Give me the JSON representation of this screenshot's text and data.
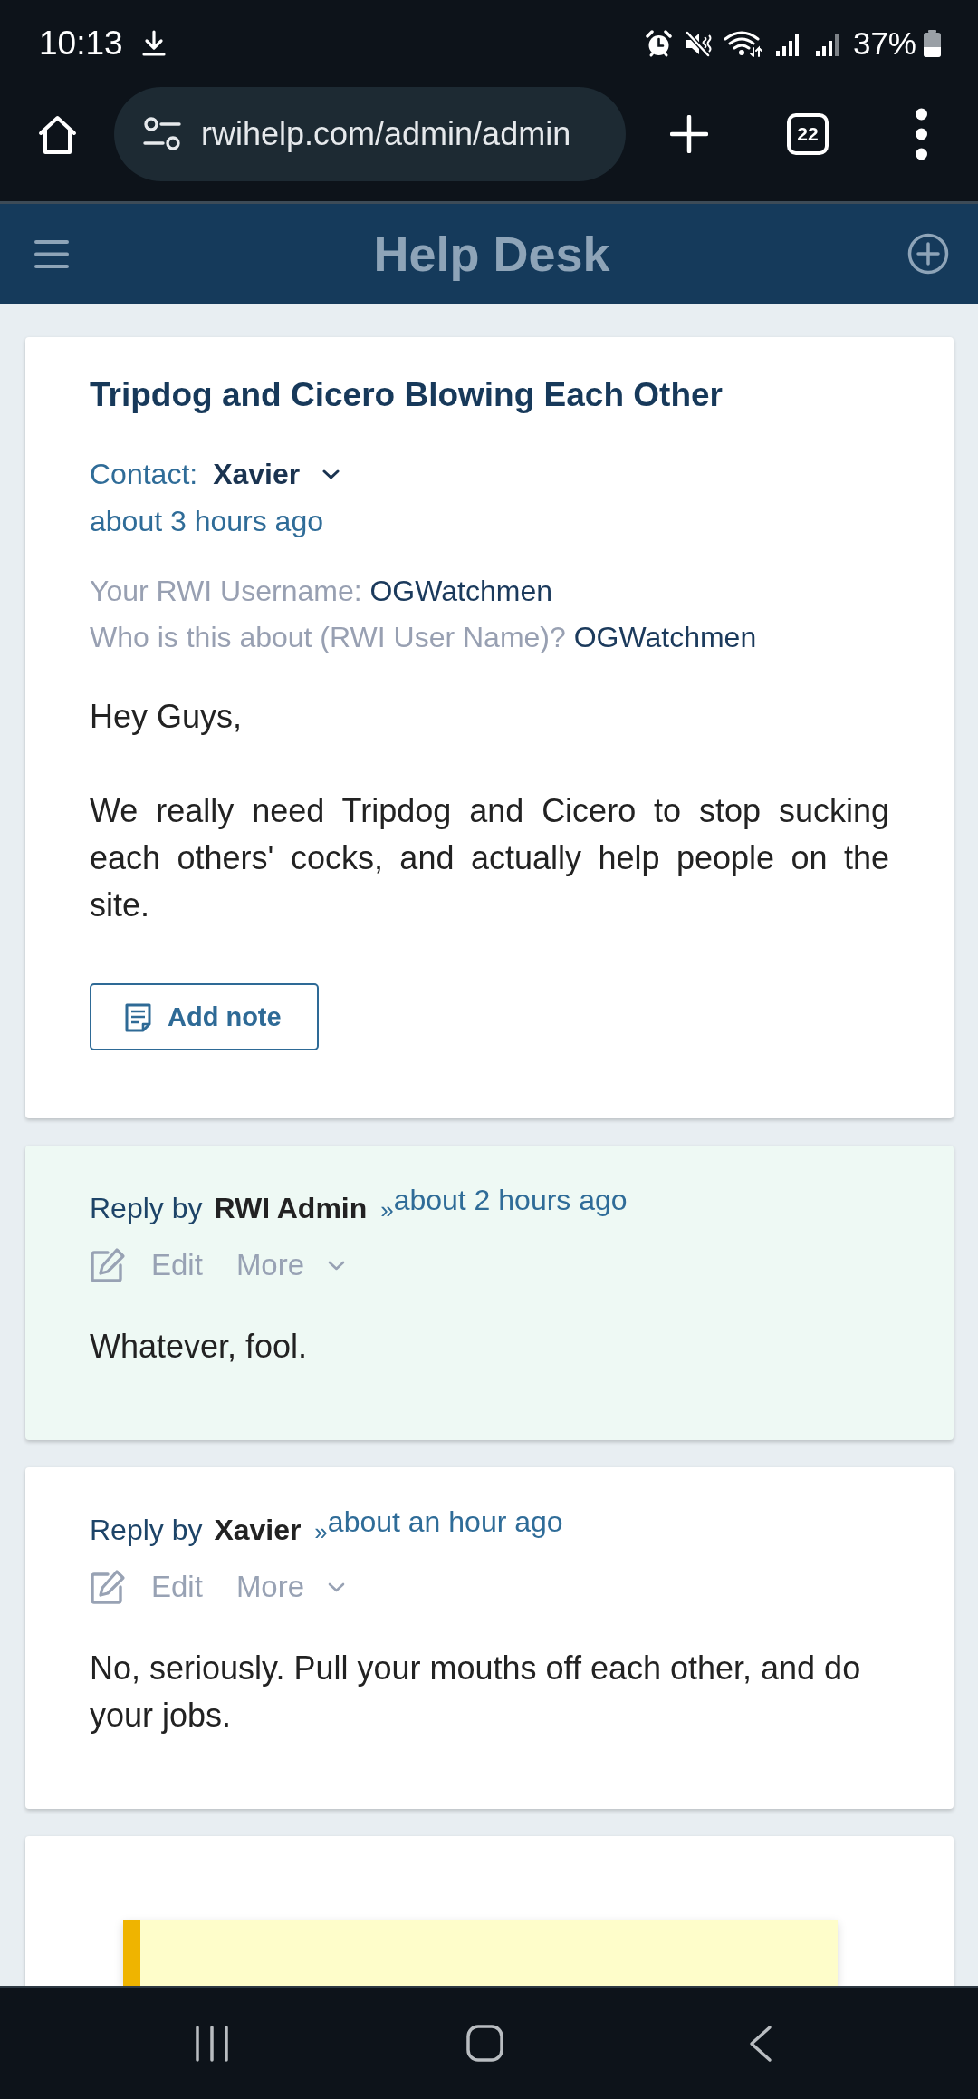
{
  "status_bar": {
    "time": "10:13",
    "battery": "37%"
  },
  "browser_bar": {
    "url": "rwihelp.com/admin/admin",
    "tab_count": "22"
  },
  "header": {
    "title": "Help Desk"
  },
  "ticket": {
    "title": "Tripdog and Cicero Blowing Each Other",
    "contact_label": "Contact:",
    "contact_name": "Xavier",
    "time": "about 3 hours ago",
    "fields": [
      {
        "label": "Your RWI Username:",
        "value": "OGWatchmen"
      },
      {
        "label": "Who is this about (RWI User Name)?",
        "value": "OGWatchmen"
      }
    ],
    "body": [
      "Hey Guys,",
      "We really need Tripdog and Cicero to stop sucking each others' cocks, and actually help people on the site."
    ],
    "add_note_button": "Add note"
  },
  "replies": [
    {
      "prefix": "Reply by",
      "author": "RWI Admin",
      "separator": "»",
      "time": "about 2 hours ago",
      "highlighted": true,
      "actions": [
        {
          "kind": "edit",
          "label": "Edit"
        },
        {
          "kind": "menu",
          "label": "More"
        }
      ],
      "body": [
        "Whatever, fool."
      ]
    },
    {
      "prefix": "Reply by",
      "author": "Xavier",
      "separator": "»",
      "time": "about an hour ago",
      "highlighted": false,
      "actions": [
        {
          "kind": "edit",
          "label": "Edit"
        },
        {
          "kind": "menu",
          "label": "More"
        }
      ],
      "body": [
        "No, seriously. Pull your mouths off each other, and do your jobs."
      ]
    }
  ]
}
